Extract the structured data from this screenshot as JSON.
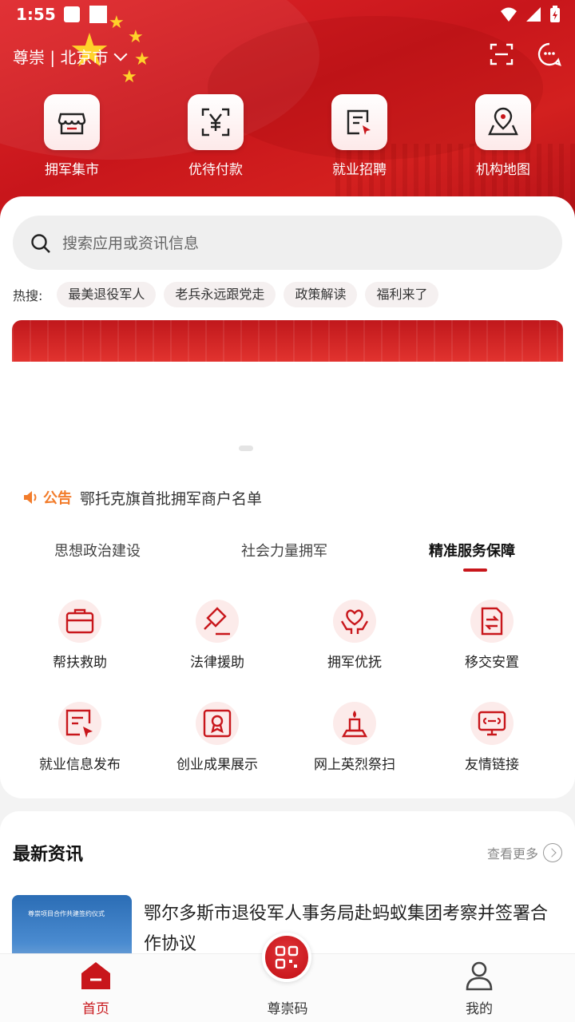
{
  "status": {
    "time": "1:55"
  },
  "header": {
    "location": "尊崇 | 北京市",
    "quick": [
      {
        "label": "拥军集市",
        "icon": "market-icon"
      },
      {
        "label": "优待付款",
        "icon": "yuan-scan-icon"
      },
      {
        "label": "就业招聘",
        "icon": "job-icon"
      },
      {
        "label": "机构地图",
        "icon": "map-pin-icon"
      }
    ]
  },
  "search": {
    "placeholder": "搜索应用或资讯信息"
  },
  "hot": {
    "label": "热搜:",
    "tags": [
      "最美退役军人",
      "老兵永远跟党走",
      "政策解读",
      "福利来了"
    ]
  },
  "notice": {
    "tag": "公告",
    "text": "鄂托克旗首批拥军商户名单"
  },
  "tabs": [
    "思想政治建设",
    "社会力量拥军",
    "精准服务保障"
  ],
  "services": [
    {
      "label": "帮扶救助",
      "icon": "briefcase-icon"
    },
    {
      "label": "法律援助",
      "icon": "gavel-icon"
    },
    {
      "label": "拥军优抚",
      "icon": "heart-hands-icon"
    },
    {
      "label": "移交安置",
      "icon": "transfer-doc-icon"
    },
    {
      "label": "就业信息发布",
      "icon": "job-post-icon"
    },
    {
      "label": "创业成果展示",
      "icon": "award-icon"
    },
    {
      "label": "网上英烈祭扫",
      "icon": "candle-icon"
    },
    {
      "label": "友情链接",
      "icon": "link-monitor-icon"
    }
  ],
  "news": {
    "title": "最新资讯",
    "more": "查看更多",
    "items": [
      {
        "headline": "鄂尔多斯市退役军人事务局赴蚂蚁集团考察并签署合作协议",
        "thumb_caption": "尊崇项目合作共建签约仪式"
      }
    ]
  },
  "nav": {
    "home": "首页",
    "code": "尊崇码",
    "mine": "我的"
  },
  "colors": {
    "brand": "#c8161b",
    "notice": "#f27c2b"
  }
}
